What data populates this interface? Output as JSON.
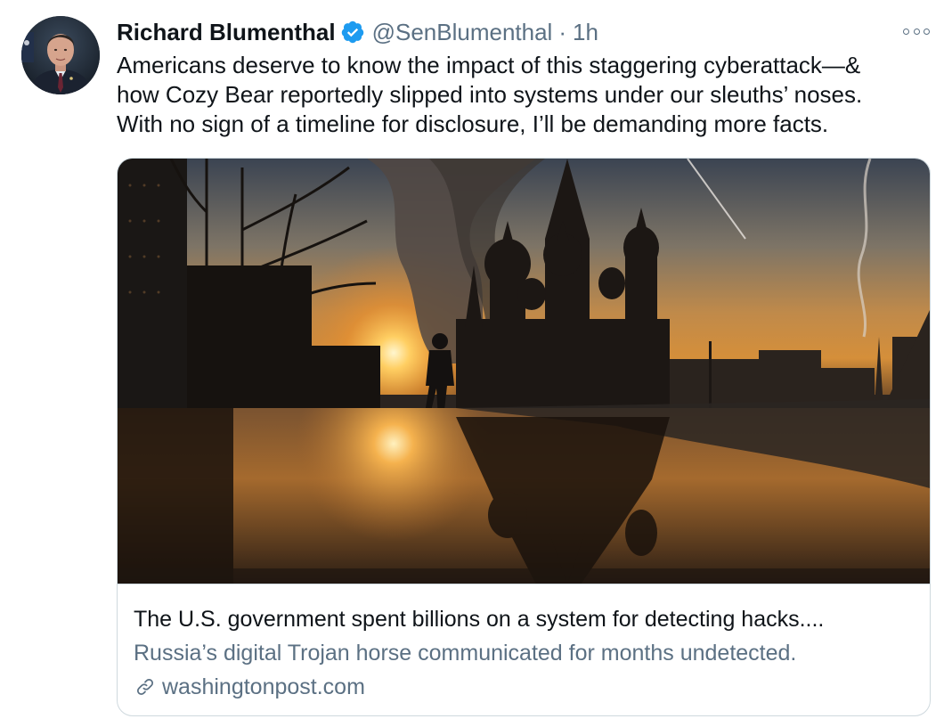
{
  "tweet": {
    "author_name": "Richard Blumenthal",
    "verified_icon": "verified-badge-icon",
    "handle": "@SenBlumenthal",
    "separator": "·",
    "time": "1h",
    "more_icon": "more-options-icon",
    "text_lines": [
      "Americans deserve to know the impact of this staggering cyberattack—&",
      "how Cozy Bear reportedly slipped into systems under our sleuths’ noses.",
      "With no sign of a timeline for disclosure, I’ll be demanding more facts."
    ]
  },
  "link_card": {
    "image_description_icon": "kremlin-sunset-photo",
    "title": "The U.S. government spent billions on a system for detecting hacks....",
    "description": "Russia’s digital Trojan horse communicated for months undetected.",
    "link_icon": "link-icon",
    "domain": "washingtonpost.com"
  },
  "colors": {
    "text_primary": "#0f1419",
    "text_secondary": "#5b7083",
    "verified_blue": "#1d9bf0",
    "card_border": "#cfd9de"
  }
}
